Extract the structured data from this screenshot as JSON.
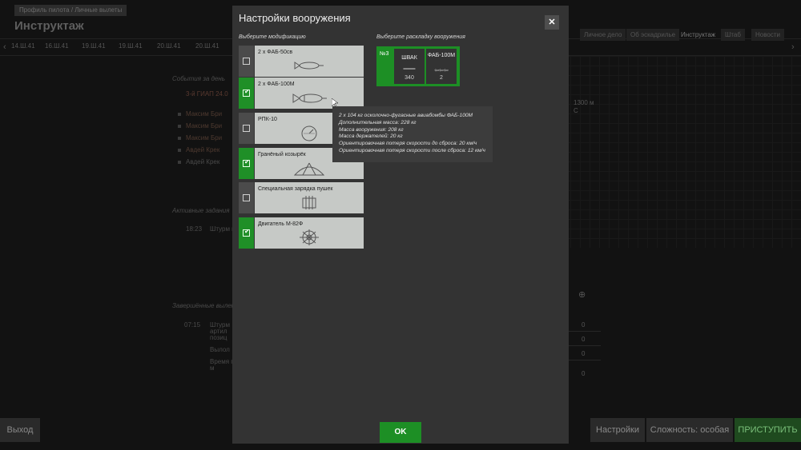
{
  "background": {
    "breadcrumb": "Профиль пилота / Личные вылеты",
    "title": "Инструктаж",
    "days": [
      "14.Ш.41",
      "16.Ш.41",
      "19.Ш.41",
      "19.Ш.41",
      "20.Ш.41",
      "20.Ш.41"
    ],
    "right_tabs": [
      "Личное дело",
      "Об эскадрилье",
      "Инструктаж",
      "Штаб",
      "Новости"
    ],
    "sections": {
      "events": "События за день",
      "active_tasks": "Активные задания",
      "completed": "Завершённые вылет"
    },
    "events": [
      "3-й ГИАП 24.0",
      "Максим Бри",
      "Максим Бри",
      "Максим Бри",
      "Авдей Крек",
      "Авдей Крек"
    ],
    "active_task_time": "18:23",
    "active_task_text": "Штурм перег",
    "completed_time": "07:15",
    "completed_lines": [
      "Штурм",
      "артил",
      "позиц",
      "Вылол",
      "Время п",
      "м"
    ],
    "right_texts": [
      "1300 м",
      "С"
    ],
    "zeros": [
      "0",
      "0",
      "0",
      "0"
    ],
    "buttons": {
      "exit": "Выход",
      "settings": "Настройки",
      "difficulty": "Сложность: особая",
      "start": "ПРИСТУПИТЬ"
    }
  },
  "modal": {
    "title": "Настройки вооружения",
    "close_label": "✕",
    "mods_heading": "Выберите модификацию",
    "loadout_heading": "Выберите раскладку вооружения",
    "modifications": [
      {
        "label": "2 х ФАБ-50св",
        "checked": false,
        "icon": "small-bomb-icon"
      },
      {
        "label": "2 х ФАБ-100М",
        "checked": true,
        "icon": "bomb-icon"
      },
      {
        "label": "РПК-10",
        "checked": false,
        "icon": "radio-compass-icon"
      },
      {
        "label": "Гранёный козырёк",
        "checked": true,
        "icon": "canopy-icon"
      },
      {
        "label": "Специальная зарядка пушек",
        "checked": false,
        "icon": "ammo-belt-icon"
      },
      {
        "label": "Двигатель М-82Ф",
        "checked": true,
        "icon": "engine-icon"
      }
    ],
    "loadout": {
      "number": "№3",
      "slots": [
        {
          "name": "ШВАК",
          "icon": "═══",
          "count": "340"
        },
        {
          "name": "ФАБ-100М",
          "icon": "⇦⇦⇦",
          "count": "2"
        }
      ]
    },
    "tooltip": [
      "2 х 104 кг осколочно-фугасные авиабомбы ФАБ-100М",
      "Дополнительная масса: 228 кг",
      "Масса вооружения: 208 кг",
      "Масса держателей: 20 кг",
      "Ориентировочная потеря скорости до сброса: 20 км/ч",
      "Ориентировочная потеря скорости после сброса: 12 км/ч"
    ],
    "ok_label": "OK"
  }
}
